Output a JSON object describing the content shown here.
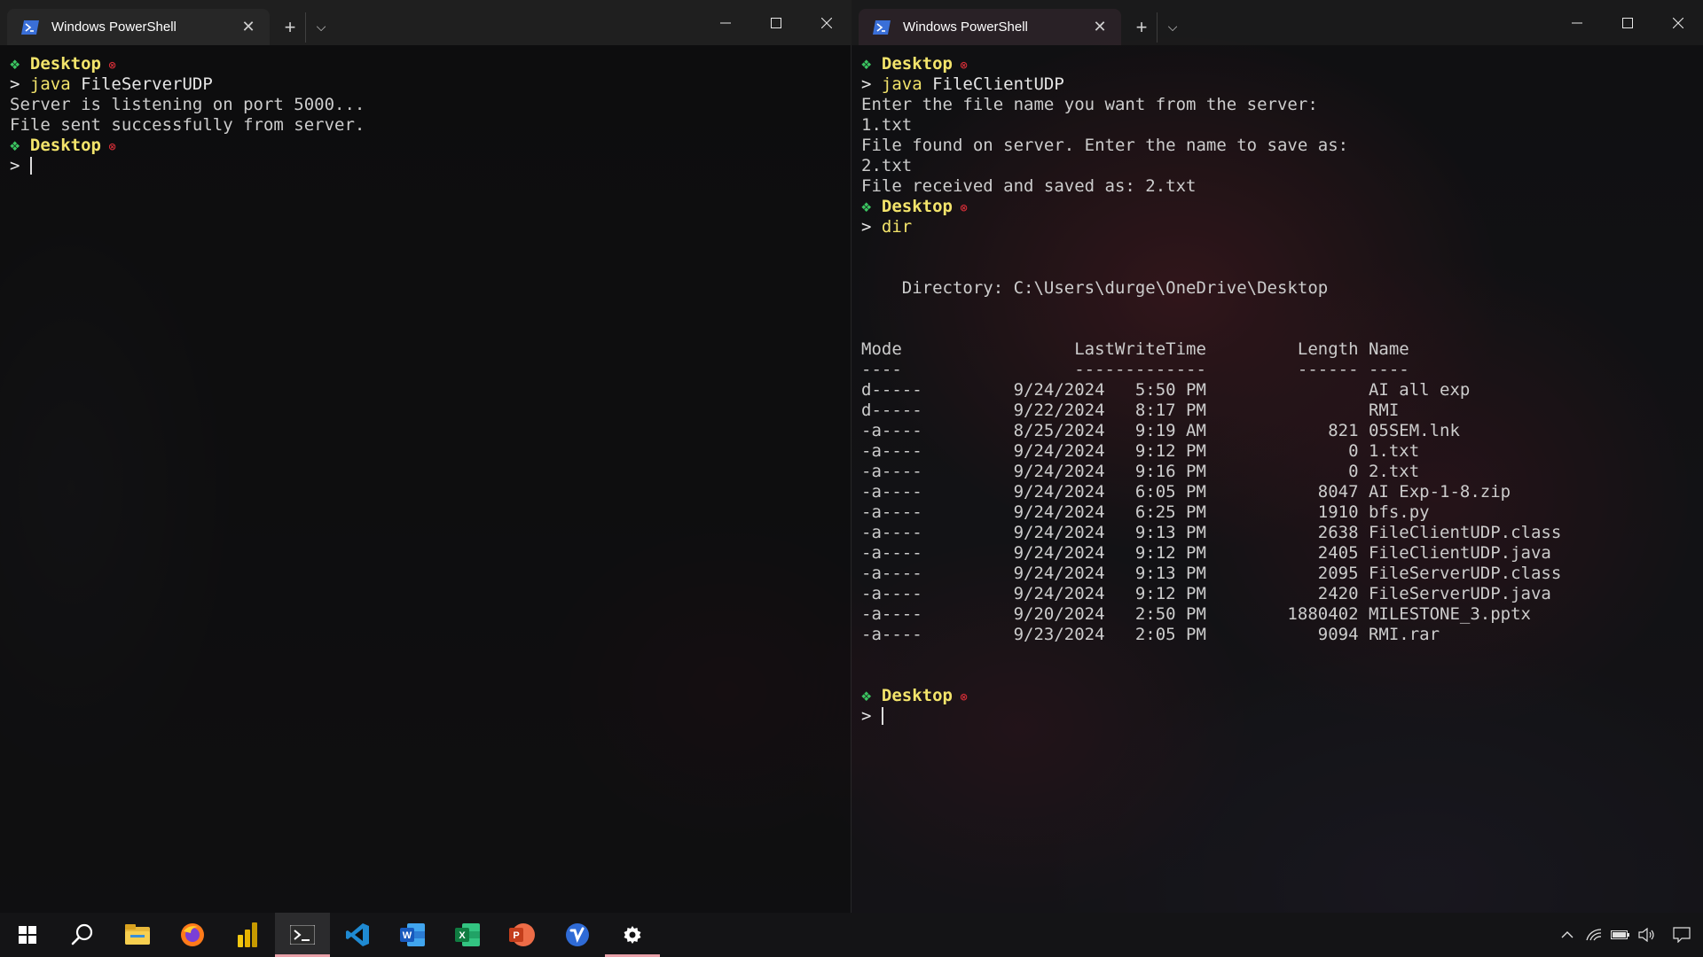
{
  "windows": [
    {
      "tab_title": "Windows PowerShell",
      "lines": [
        {
          "kind": "prompt",
          "folder": "Desktop"
        },
        {
          "kind": "cmd",
          "prefix": "> ",
          "command": "java",
          "args": " FileServerUDP"
        },
        {
          "kind": "out",
          "text": "Server is listening on port 5000..."
        },
        {
          "kind": "out",
          "text": "File sent successfully from server."
        },
        {
          "kind": "prompt",
          "folder": "Desktop"
        },
        {
          "kind": "input",
          "prefix": "> "
        }
      ]
    },
    {
      "tab_title": "Windows PowerShell",
      "lines": [
        {
          "kind": "prompt",
          "folder": "Desktop"
        },
        {
          "kind": "cmd",
          "prefix": "> ",
          "command": "java",
          "args": " FileClientUDP"
        },
        {
          "kind": "out",
          "text": "Enter the file name you want from the server:"
        },
        {
          "kind": "out",
          "text": "1.txt"
        },
        {
          "kind": "out",
          "text": "File found on server. Enter the name to save as:"
        },
        {
          "kind": "out",
          "text": "2.txt"
        },
        {
          "kind": "out",
          "text": "File received and saved as: 2.txt"
        },
        {
          "kind": "prompt",
          "folder": "Desktop"
        },
        {
          "kind": "cmd",
          "prefix": "> ",
          "command": "dir",
          "args": ""
        },
        {
          "kind": "out",
          "text": ""
        },
        {
          "kind": "out",
          "text": ""
        },
        {
          "kind": "out",
          "text": "    Directory: C:\\Users\\durge\\OneDrive\\Desktop"
        },
        {
          "kind": "out",
          "text": ""
        },
        {
          "kind": "out",
          "text": ""
        },
        {
          "kind": "out",
          "text": "Mode                 LastWriteTime         Length Name"
        },
        {
          "kind": "out",
          "text": "----                 -------------         ------ ----"
        },
        {
          "kind": "out",
          "text": "d-----         9/24/2024   5:50 PM                AI all exp"
        },
        {
          "kind": "out",
          "text": "d-----         9/22/2024   8:17 PM                RMI"
        },
        {
          "kind": "out",
          "text": "-a----         8/25/2024   9:19 AM            821 05SEM.lnk"
        },
        {
          "kind": "out",
          "text": "-a----         9/24/2024   9:12 PM              0 1.txt"
        },
        {
          "kind": "out",
          "text": "-a----         9/24/2024   9:16 PM              0 2.txt"
        },
        {
          "kind": "out",
          "text": "-a----         9/24/2024   6:05 PM           8047 AI Exp-1-8.zip"
        },
        {
          "kind": "out",
          "text": "-a----         9/24/2024   6:25 PM           1910 bfs.py"
        },
        {
          "kind": "out",
          "text": "-a----         9/24/2024   9:13 PM           2638 FileClientUDP.class"
        },
        {
          "kind": "out",
          "text": "-a----         9/24/2024   9:12 PM           2405 FileClientUDP.java"
        },
        {
          "kind": "out",
          "text": "-a----         9/24/2024   9:13 PM           2095 FileServerUDP.class"
        },
        {
          "kind": "out",
          "text": "-a----         9/24/2024   9:12 PM           2420 FileServerUDP.java"
        },
        {
          "kind": "out",
          "text": "-a----         9/20/2024   2:50 PM        1880402 MILESTONE_3.pptx"
        },
        {
          "kind": "out",
          "text": "-a----         9/23/2024   2:05 PM           9094 RMI.rar"
        },
        {
          "kind": "out",
          "text": ""
        },
        {
          "kind": "out",
          "text": ""
        },
        {
          "kind": "prompt",
          "folder": "Desktop"
        },
        {
          "kind": "input",
          "prefix": "> "
        }
      ]
    }
  ],
  "taskbar": {
    "items": [
      {
        "name": "start-icon",
        "state": "none"
      },
      {
        "name": "search-icon",
        "state": "none"
      },
      {
        "name": "file-explorer-icon",
        "state": "none"
      },
      {
        "name": "firefox-icon",
        "state": "none"
      },
      {
        "name": "power-bi-icon",
        "state": "none"
      },
      {
        "name": "terminal-icon",
        "state": "active"
      },
      {
        "name": "vscode-icon",
        "state": "none"
      },
      {
        "name": "word-icon",
        "state": "none"
      },
      {
        "name": "excel-icon",
        "state": "none"
      },
      {
        "name": "powerpoint-icon",
        "state": "none"
      },
      {
        "name": "vimeo-icon",
        "state": "none"
      },
      {
        "name": "settings-icon",
        "state": "running"
      }
    ],
    "tray": [
      "chevron-up-icon",
      "wifi-icon",
      "battery-icon",
      "volume-icon",
      "notification-icon"
    ]
  },
  "colors": {
    "prompt_diamond": "#3bc461",
    "prompt_folder": "#f3e46b",
    "prompt_dot": "#e0303a",
    "command": "#f3e46b",
    "text": "#cccccc",
    "accent": "#c42b3c"
  }
}
